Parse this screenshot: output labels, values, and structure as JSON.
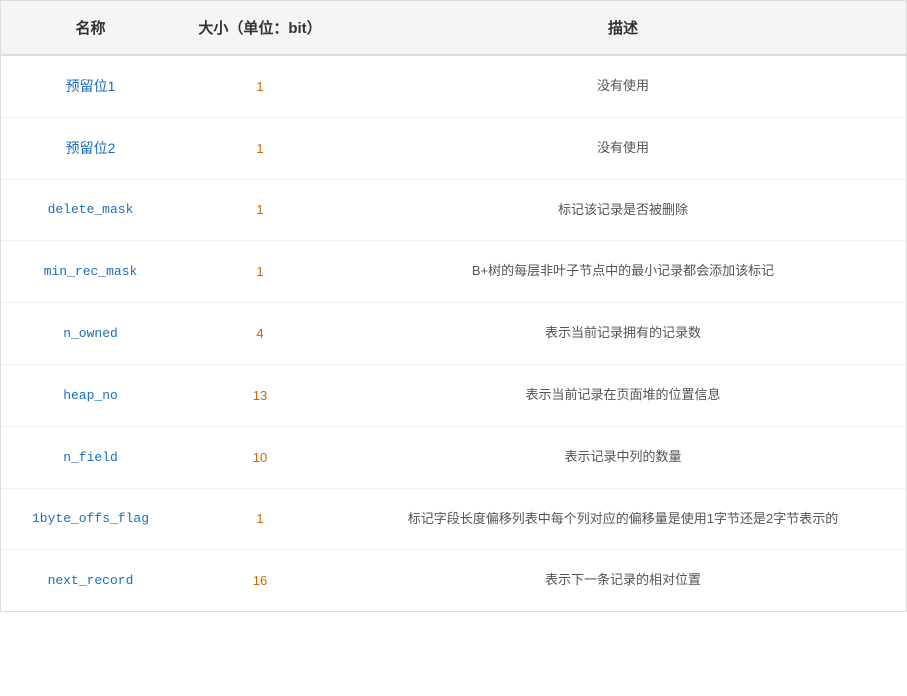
{
  "table": {
    "headers": {
      "name": "名称",
      "size": "大小（单位：bit）",
      "desc": "描述"
    },
    "rows": [
      {
        "name": "预留位1",
        "name_type": "chinese",
        "size": "1",
        "desc": "没有使用"
      },
      {
        "name": "预留位2",
        "name_type": "chinese",
        "size": "1",
        "desc": "没有使用"
      },
      {
        "name": "delete_mask",
        "name_type": "code",
        "size": "1",
        "desc": "标记该记录是否被删除"
      },
      {
        "name": "min_rec_mask",
        "name_type": "code",
        "size": "1",
        "desc": "B+树的每层非叶子节点中的最小记录都会添加该标记"
      },
      {
        "name": "n_owned",
        "name_type": "code",
        "size": "4",
        "desc": "表示当前记录拥有的记录数"
      },
      {
        "name": "heap_no",
        "name_type": "code",
        "size": "13",
        "desc": "表示当前记录在页面堆的位置信息"
      },
      {
        "name": "n_field",
        "name_type": "code",
        "size": "10",
        "desc": "表示记录中列的数量"
      },
      {
        "name": "1byte_offs_flag",
        "name_type": "code",
        "size": "1",
        "desc": "标记字段长度偏移列表中每个列对应的偏移量是使用1字节还是2字节表示的"
      },
      {
        "name": "next_record",
        "name_type": "code",
        "size": "16",
        "desc": "表示下一条记录的相对位置"
      }
    ]
  }
}
